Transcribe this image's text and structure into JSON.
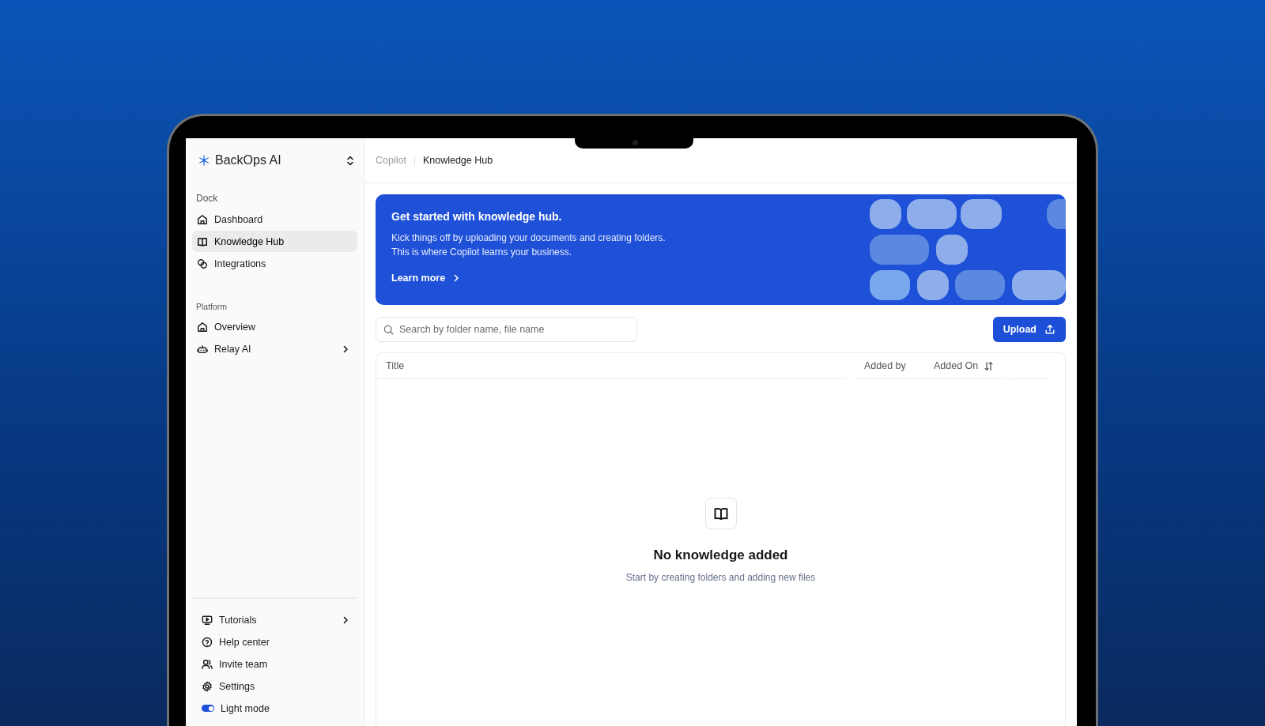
{
  "sidebar": {
    "brand": "BackOps AI",
    "sections": [
      {
        "heading": "Dock",
        "items": [
          {
            "label": "Dashboard",
            "selected": false,
            "submenu": false
          },
          {
            "label": "Knowledge Hub",
            "selected": true,
            "submenu": false
          },
          {
            "label": "Integrations",
            "selected": false,
            "submenu": false
          }
        ]
      },
      {
        "heading": "Platform",
        "items": [
          {
            "label": "Overview",
            "selected": false,
            "submenu": false
          },
          {
            "label": "Relay AI",
            "selected": false,
            "submenu": true
          }
        ]
      }
    ],
    "footer_items": [
      {
        "label": "Tutorials",
        "selected": false,
        "submenu": true
      },
      {
        "label": "Help center",
        "selected": false,
        "submenu": false
      },
      {
        "label": "Invite team",
        "selected": false,
        "submenu": false
      },
      {
        "label": "Settings",
        "selected": false,
        "submenu": false
      }
    ],
    "theme_toggle": {
      "label": "Light mode",
      "on": true
    }
  },
  "breadcrumb": [
    {
      "label": "Copilot",
      "current": false
    },
    {
      "label": "Knowledge Hub",
      "current": true
    }
  ],
  "banner": {
    "title": "Get started with knowledge hub.",
    "lines": [
      "Kick things off by uploading your documents and creating folders.",
      "This is where Copilot learns your business."
    ],
    "link": "Learn more"
  },
  "search": {
    "placeholder": "Search by folder name, file name"
  },
  "upload_button": "Upload",
  "table": {
    "columns": [
      {
        "label": "Title",
        "sortable": false
      },
      {
        "label": "Added by",
        "sortable": false
      },
      {
        "label": "Added On",
        "sortable": true
      }
    ]
  },
  "empty_state": {
    "title": "No knowledge added",
    "text": "Start by creating folders and adding new files"
  }
}
